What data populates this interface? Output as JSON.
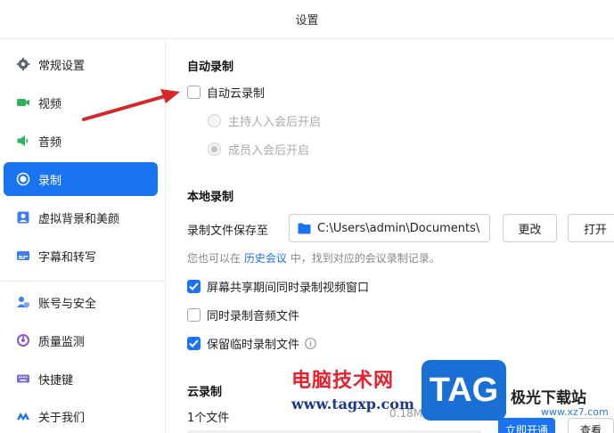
{
  "window": {
    "title": "设置"
  },
  "sidebar": {
    "items": [
      {
        "label": "常规设置",
        "icon": "gear-icon"
      },
      {
        "label": "视频",
        "icon": "video-icon"
      },
      {
        "label": "音频",
        "icon": "audio-icon"
      },
      {
        "label": "录制",
        "icon": "record-icon",
        "active": true
      },
      {
        "label": "虚拟背景和美颜",
        "icon": "portrait-icon"
      },
      {
        "label": "字幕和转写",
        "icon": "subtitle-icon"
      },
      {
        "label": "账号与安全",
        "icon": "account-security-icon"
      },
      {
        "label": "质量监测",
        "icon": "quality-monitor-icon"
      },
      {
        "label": "快捷键",
        "icon": "keyboard-icon"
      },
      {
        "label": "关于我们",
        "icon": "about-logo-icon"
      }
    ]
  },
  "auto_record": {
    "title": "自动录制",
    "cloud_record_label": "自动云录制",
    "cloud_record_checked": false,
    "options": [
      {
        "label": "主持人入会后开启",
        "selected": false
      },
      {
        "label": "成员入会后开启",
        "selected": true
      }
    ]
  },
  "local_record": {
    "title": "本地录制",
    "save_to_label": "录制文件保存至",
    "save_path": "C:\\Users\\admin\\Documents\\",
    "change_button": "更改",
    "open_button": "打开",
    "hint_prefix": "您也可以在",
    "hint_link": "历史会议",
    "hint_suffix": "中，找到对应的会议录制记录。",
    "options": [
      {
        "label": "屏幕共享期间同时录制视频窗口",
        "checked": true
      },
      {
        "label": "同时录制音频文件",
        "checked": false
      },
      {
        "label": "保留临时录制文件",
        "checked": true,
        "info": true
      }
    ]
  },
  "cloud_record": {
    "title": "云录制",
    "file_count": "1个文件",
    "usage": "0.18MB/1GB",
    "open_button": "立即开通",
    "view_button": "查看"
  },
  "watermark": {
    "site_name": "电脑技术网",
    "site_url": "www.tagxp.com",
    "tag_text": "TAG",
    "jg_name": "极光下载站",
    "jg_url": "www.xz7.com"
  },
  "colors": {
    "accent": "#1a73f0",
    "arrow": "#d22a2a"
  }
}
